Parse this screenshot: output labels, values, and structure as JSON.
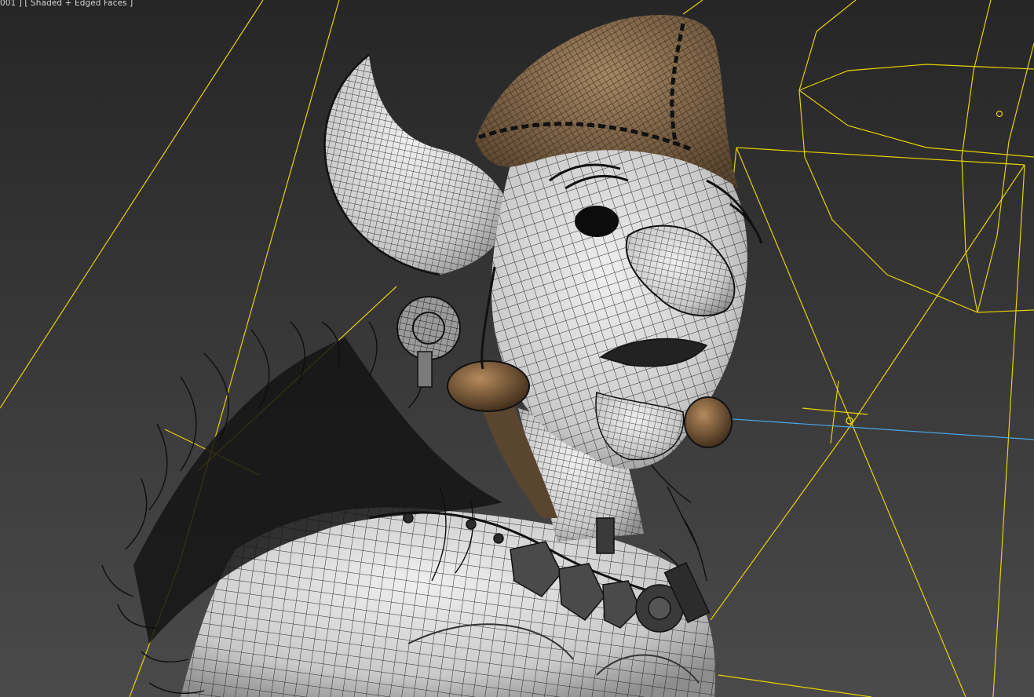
{
  "viewport": {
    "label": "001 ] [ Shaded + Edged Faces ]",
    "shading_mode": "Shaded + Edged Faces",
    "scene_subject": "goblin character bust with wireframe overlay"
  },
  "colors": {
    "background_top": "#262626",
    "background_bottom": "#4a4a4a",
    "skin": "#d9d9d9",
    "wire": "#1a1a1a",
    "hat": "#7a6246",
    "gizmo_yellow": "#e8d000",
    "gizmo_blue": "#4aa8e8",
    "fur": "#0e0e0e"
  },
  "icons": [
    "helper-target-icon",
    "light-gizmo-icon"
  ]
}
